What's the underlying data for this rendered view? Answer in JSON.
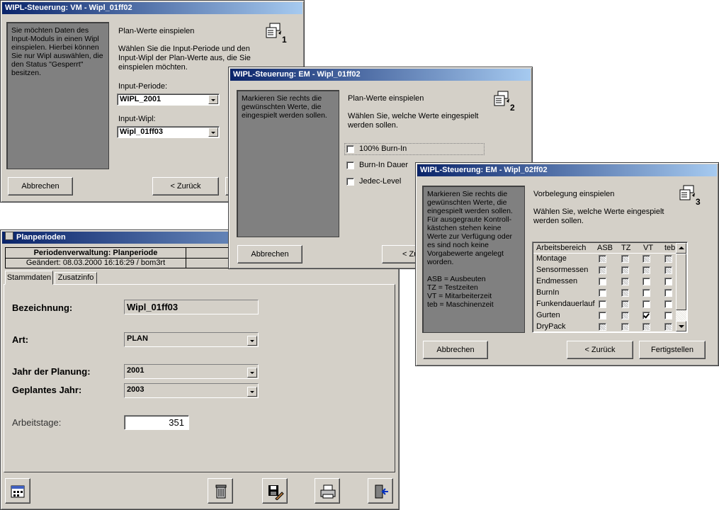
{
  "win1": {
    "title": "WIPL-Steuerung:  VM - Wipl_01ff02",
    "info": "Sie möchten Daten des Input-Moduls in einen Wipl einspielen. Hierbei können Sie nur Wipl auswählen, die den Status \"Gesperrt\" besitzen.",
    "heading": "Plan-Werte einspielen",
    "description": "Wählen Sie die Input-Periode und den Input-Wipl der Plan-Werte aus, die Sie einspielen möchten.",
    "periode_label": "Input-Periode:",
    "periode_value": "WIPL_2001",
    "wipl_label": "Input-Wipl:",
    "wipl_value": "Wipl_01ff03",
    "step": "1",
    "cancel_label": "Abbrechen",
    "back_label": "< Zurück"
  },
  "win2": {
    "title": "WIPL-Steuerung:  EM - Wipl_01ff02",
    "info": "Markieren Sie rechts die gewünschten Werte, die eingespielt werden sollen.",
    "heading": "Plan-Werte einspielen",
    "description": "Wählen Sie, welche Werte eingespielt werden sollen.",
    "options": [
      {
        "label": "100% Burn-In",
        "checked": false
      },
      {
        "label": "Burn-In Dauer",
        "checked": false
      },
      {
        "label": "Jedec-Level",
        "checked": false
      }
    ],
    "step": "2",
    "cancel_label": "Abbrechen",
    "back_label": "< Zu"
  },
  "win3": {
    "title": "WIPL-Steuerung:  EM - Wipl_02ff02",
    "info": "Markieren Sie rechts die gewünschten Werte, die eingespielt werden sollen. Für ausgegraute Kontroll-kästchen stehen keine Werte zur Verfügung oder es sind noch keine Vorgabewerte angelegt worden.",
    "legend": "ASB = Ausbeuten\nTZ = Testzeiten\nVT = Mitarbeiterzeit\nteb = Maschinenzeit",
    "heading": "Vorbelegung einspielen",
    "description": "Wählen Sie, welche Werte eingespielt werden sollen.",
    "columns": [
      "Arbeitsbereich",
      "ASB",
      "TZ",
      "VT",
      "teb"
    ],
    "rows": [
      {
        "name": "Montage",
        "states": [
          "grey",
          "grey",
          "grey",
          "grey"
        ]
      },
      {
        "name": "Sensormessen",
        "states": [
          "grey",
          "grey",
          "grey",
          "grey"
        ]
      },
      {
        "name": "Endmessen",
        "states": [
          "empty",
          "grey",
          "empty",
          "empty"
        ]
      },
      {
        "name": "BurnIn",
        "states": [
          "empty",
          "grey",
          "empty",
          "empty"
        ]
      },
      {
        "name": "Funkendauerlauf",
        "states": [
          "empty",
          "grey",
          "empty",
          "empty"
        ]
      },
      {
        "name": "Gurten",
        "states": [
          "empty",
          "grey",
          "checked",
          "empty"
        ]
      },
      {
        "name": "DryPack",
        "states": [
          "grey",
          "grey",
          "grey",
          "grey"
        ]
      }
    ],
    "step": "3",
    "cancel_label": "Abbrechen",
    "back_label": "< Zurück",
    "finish_label": "Fertigstellen"
  },
  "win4": {
    "title": "Planperioden",
    "header_title": "Periodenverwaltung: Planperiode",
    "changed": "Geändert: 08.03.2000 16:16:29 / bom3rt",
    "tabs": [
      "Stammdaten",
      "Zusatzinfo"
    ],
    "bezeichnung_label": "Bezeichnung:",
    "bezeichnung_value": "Wipl_01ff03",
    "art_label": "Art:",
    "art_value": "PLAN",
    "jahr_label": "Jahr der Planung:",
    "jahr_value": "2001",
    "geplant_label": "Geplantes Jahr:",
    "geplant_value": "2003",
    "arbeitstage_label": "Arbeitstage:",
    "arbeitstage_value": "351"
  }
}
